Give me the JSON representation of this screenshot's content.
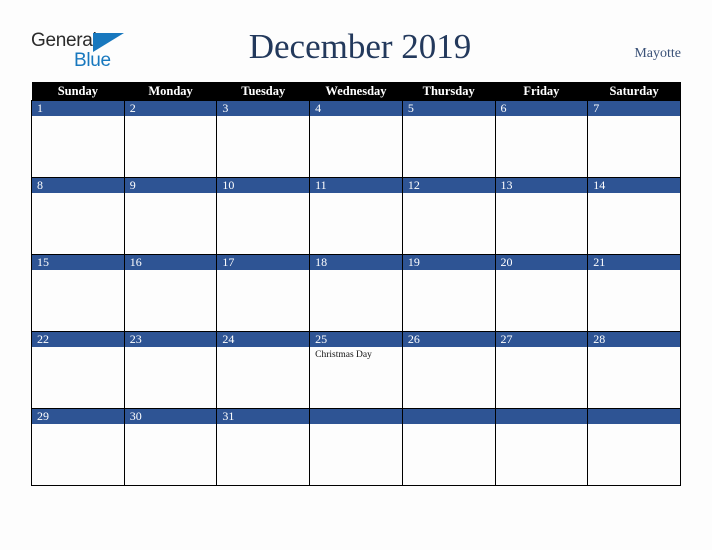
{
  "logo": {
    "word_one": "General",
    "word_two": "Blue",
    "triangle_color": "#1878be",
    "text_color": "#2b2b2b"
  },
  "header": {
    "title": "December 2019",
    "locale": "Mayotte",
    "title_color": "#23395c",
    "locale_color": "#3b5278"
  },
  "calendar": {
    "weekdays": [
      "Sunday",
      "Monday",
      "Tuesday",
      "Wednesday",
      "Thursday",
      "Friday",
      "Saturday"
    ],
    "header_bg": "#000000",
    "header_fg": "#ffffff",
    "date_band_color": "#2e5494",
    "date_text_color": "#ffffff",
    "cell_bg": "#fdfdfd",
    "border_color": "#000000",
    "weeks": [
      [
        {
          "date": "1",
          "events": []
        },
        {
          "date": "2",
          "events": []
        },
        {
          "date": "3",
          "events": []
        },
        {
          "date": "4",
          "events": []
        },
        {
          "date": "5",
          "events": []
        },
        {
          "date": "6",
          "events": []
        },
        {
          "date": "7",
          "events": []
        }
      ],
      [
        {
          "date": "8",
          "events": []
        },
        {
          "date": "9",
          "events": []
        },
        {
          "date": "10",
          "events": []
        },
        {
          "date": "11",
          "events": []
        },
        {
          "date": "12",
          "events": []
        },
        {
          "date": "13",
          "events": []
        },
        {
          "date": "14",
          "events": []
        }
      ],
      [
        {
          "date": "15",
          "events": []
        },
        {
          "date": "16",
          "events": []
        },
        {
          "date": "17",
          "events": []
        },
        {
          "date": "18",
          "events": []
        },
        {
          "date": "19",
          "events": []
        },
        {
          "date": "20",
          "events": []
        },
        {
          "date": "21",
          "events": []
        }
      ],
      [
        {
          "date": "22",
          "events": []
        },
        {
          "date": "23",
          "events": []
        },
        {
          "date": "24",
          "events": []
        },
        {
          "date": "25",
          "events": [
            "Christmas Day"
          ]
        },
        {
          "date": "26",
          "events": []
        },
        {
          "date": "27",
          "events": []
        },
        {
          "date": "28",
          "events": []
        }
      ],
      [
        {
          "date": "29",
          "events": []
        },
        {
          "date": "30",
          "events": []
        },
        {
          "date": "31",
          "events": []
        },
        {
          "date": "",
          "events": []
        },
        {
          "date": "",
          "events": []
        },
        {
          "date": "",
          "events": []
        },
        {
          "date": "",
          "events": []
        }
      ]
    ]
  }
}
